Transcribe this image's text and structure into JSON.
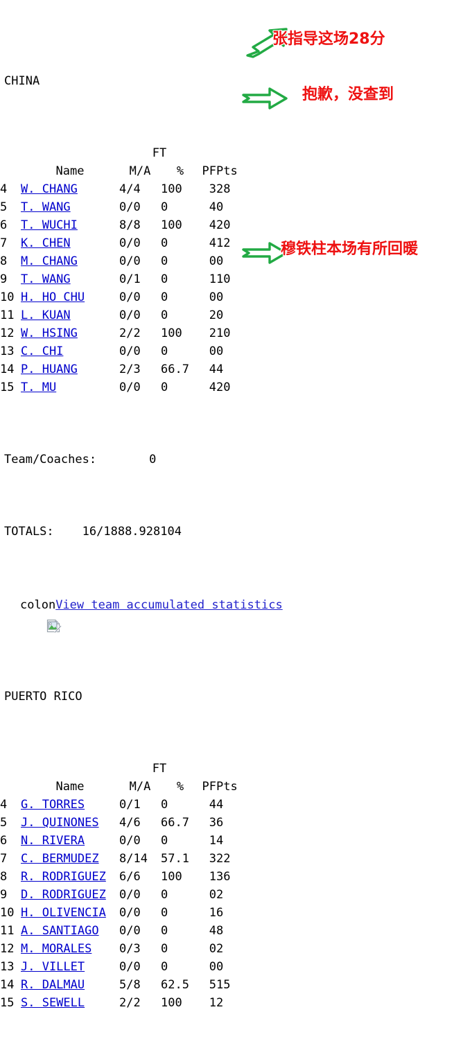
{
  "colors": {
    "link": "#0000cc",
    "annotation_text": "#ee1111",
    "annotation_arrow": "#22aa44",
    "body_text": "#000000"
  },
  "teams": [
    {
      "name": "CHINA",
      "headers": {
        "group": "FT",
        "number": "",
        "name": "Name",
        "ma": "M/A",
        "pct": "%",
        "pf": "PF",
        "pts": "Pts"
      },
      "players": [
        {
          "num": "4",
          "name": "W. CHANG",
          "ma": "4/4",
          "pct": "100",
          "pf": "3",
          "pts": "28"
        },
        {
          "num": "5",
          "name": "T. WANG",
          "ma": "0/0",
          "pct": "0",
          "pf": "4",
          "pts": "0"
        },
        {
          "num": "6",
          "name": "T. WUCHI",
          "ma": "8/8",
          "pct": "100",
          "pf": "4",
          "pts": "20"
        },
        {
          "num": "7",
          "name": "K. CHEN",
          "ma": "0/0",
          "pct": "0",
          "pf": "4",
          "pts": "12"
        },
        {
          "num": "8",
          "name": "M. CHANG",
          "ma": "0/0",
          "pct": "0",
          "pf": "0",
          "pts": "0"
        },
        {
          "num": "9",
          "name": "T. WANG",
          "ma": "0/1",
          "pct": "0",
          "pf": "1",
          "pts": "10"
        },
        {
          "num": "10",
          "name": "H. HO CHU",
          "ma": "0/0",
          "pct": "0",
          "pf": "0",
          "pts": "0"
        },
        {
          "num": "11",
          "name": "L. KUAN",
          "ma": "0/0",
          "pct": "0",
          "pf": "2",
          "pts": "0"
        },
        {
          "num": "12",
          "name": "W. HSING",
          "ma": "2/2",
          "pct": "100",
          "pf": "2",
          "pts": "10"
        },
        {
          "num": "13",
          "name": "C. CHI",
          "ma": "0/0",
          "pct": "0",
          "pf": "0",
          "pts": "0"
        },
        {
          "num": "14",
          "name": "P. HUANG",
          "ma": "2/3",
          "pct": "66.7",
          "pf": "4",
          "pts": "4"
        },
        {
          "num": "15",
          "name": "T. MU",
          "ma": "0/0",
          "pct": "0",
          "pf": "4",
          "pts": "20"
        }
      ],
      "team_coaches": {
        "label": "Team/Coaches:",
        "value": "0"
      },
      "totals": {
        "label": "TOTALS:",
        "value": "16/1888.928104"
      },
      "stat_line": {
        "prefix": "colon",
        "link": "View team accumulated statistics"
      }
    },
    {
      "name": "PUERTO RICO",
      "headers": {
        "group": "FT",
        "number": "",
        "name": "Name",
        "ma": "M/A",
        "pct": "%",
        "pf": "PF",
        "pts": "Pts"
      },
      "players": [
        {
          "num": "4",
          "name": "G. TORRES",
          "ma": "0/1",
          "pct": "0",
          "pf": "4",
          "pts": "4"
        },
        {
          "num": "5",
          "name": "J. QUINONES",
          "ma": "4/6",
          "pct": "66.7",
          "pf": "3",
          "pts": "6"
        },
        {
          "num": "6",
          "name": "N. RIVERA",
          "ma": "0/0",
          "pct": "0",
          "pf": "1",
          "pts": "4"
        },
        {
          "num": "7",
          "name": "C. BERMUDEZ",
          "ma": "8/14",
          "pct": "57.1",
          "pf": "3",
          "pts": "22"
        },
        {
          "num": "8",
          "name": "R. RODRIGUEZ",
          "ma": "6/6",
          "pct": "100",
          "pf": "1",
          "pts": "36"
        },
        {
          "num": "9",
          "name": "D. RODRIGUEZ",
          "ma": "0/0",
          "pct": "0",
          "pf": "0",
          "pts": "2"
        },
        {
          "num": "10",
          "name": "H. OLIVENCIA",
          "ma": "0/0",
          "pct": "0",
          "pf": "1",
          "pts": "6"
        },
        {
          "num": "11",
          "name": "A. SANTIAGO",
          "ma": "0/0",
          "pct": "0",
          "pf": "4",
          "pts": "8"
        },
        {
          "num": "12",
          "name": "M. MORALES",
          "ma": "0/3",
          "pct": "0",
          "pf": "0",
          "pts": "2"
        },
        {
          "num": "13",
          "name": "J. VILLET",
          "ma": "0/0",
          "pct": "0",
          "pf": "0",
          "pts": "0"
        },
        {
          "num": "14",
          "name": "R. DALMAU",
          "ma": "5/8",
          "pct": "62.5",
          "pf": "5",
          "pts": "15"
        },
        {
          "num": "15",
          "name": "S. SEWELL",
          "ma": "2/2",
          "pct": "100",
          "pf": "1",
          "pts": "2"
        }
      ]
    }
  ],
  "annotations": [
    {
      "text": "张指导这场28分",
      "arrow": "arrow-up-right-icon"
    },
    {
      "text": "抱歉，没查到",
      "arrow": "arrow-right-icon"
    },
    {
      "text": "穆铁柱本场有所回暖",
      "arrow": "arrow-right-icon"
    }
  ]
}
